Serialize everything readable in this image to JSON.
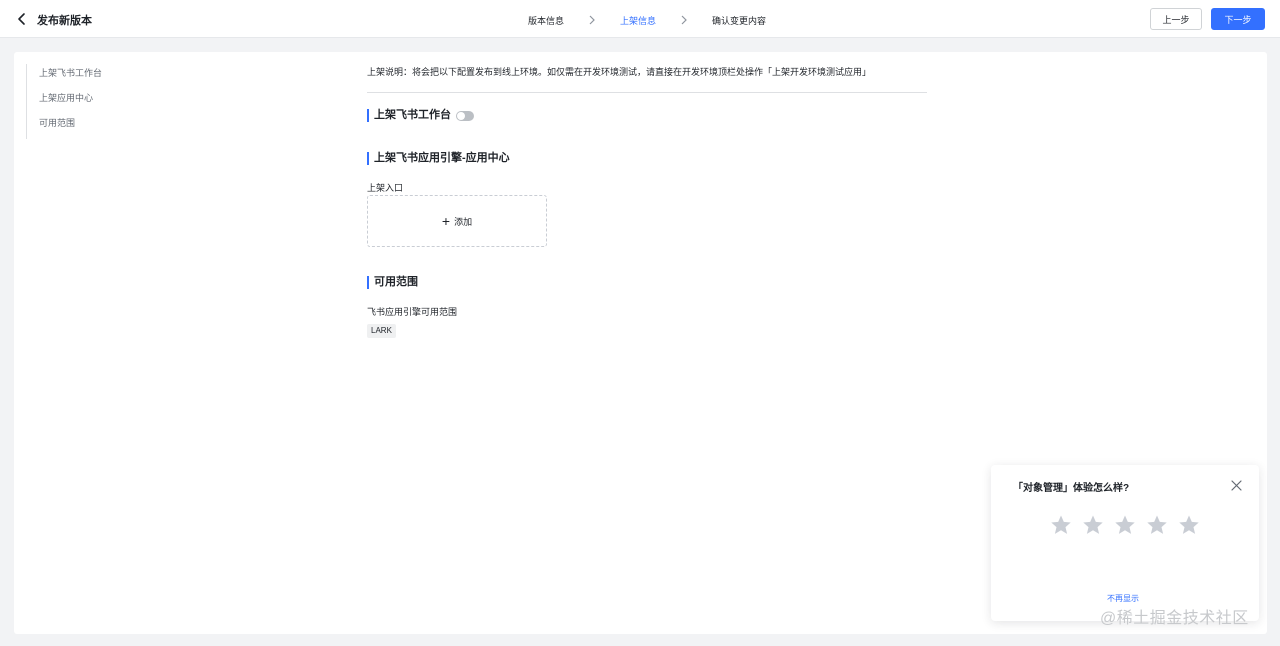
{
  "header": {
    "title": "发布新版本",
    "steps": [
      {
        "label": "版本信息",
        "active": false
      },
      {
        "label": "上架信息",
        "active": true
      },
      {
        "label": "确认变更内容",
        "active": false
      }
    ],
    "prev_label": "上一步",
    "next_label": "下一步"
  },
  "anchor": {
    "items": [
      "上架飞书工作台",
      "上架应用中心",
      "可用范围"
    ]
  },
  "content": {
    "notice": "上架说明：将会把以下配置发布到线上环境。如仅需在开发环境测试，请直接在开发环境顶栏处操作「上架开发环境测试应用」",
    "workbench_title": "上架飞书工作台",
    "workbench_enabled": false,
    "appcenter_title": "上架飞书应用引擎-应用中心",
    "entry_label": "上架入口",
    "add_label": "添加",
    "scope_title": "可用范围",
    "scope_label": "飞书应用引擎可用范围",
    "scope_tag": "LARK"
  },
  "survey": {
    "title": "「对象管理」体验怎么样?",
    "rating_max": 5,
    "rating_value": 0,
    "dismiss_label": "不再显示"
  },
  "watermark": "@稀土掘金技术社区",
  "colors": {
    "accent": "#3370ff",
    "background": "#f2f3f5",
    "star_empty": "#c9cdd4"
  }
}
